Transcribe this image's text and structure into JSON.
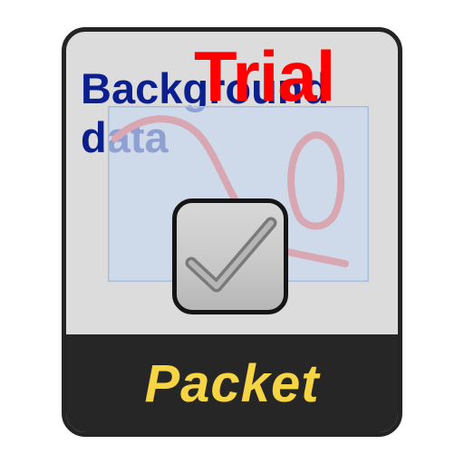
{
  "tile": {
    "background_label": "Background\ndata",
    "watermark": "Trial",
    "footer_label": "Packet",
    "icons": {
      "plot": "signal-plot-icon",
      "checkmark": "checkmark-icon"
    },
    "colors": {
      "background_label": "#0c1f8f",
      "watermark": "#ff0000",
      "footer_text": "#f6d545",
      "footer_background": "#262626",
      "plot_area": "#c8d9ee",
      "plot_curve": "#d9a7b2"
    }
  }
}
